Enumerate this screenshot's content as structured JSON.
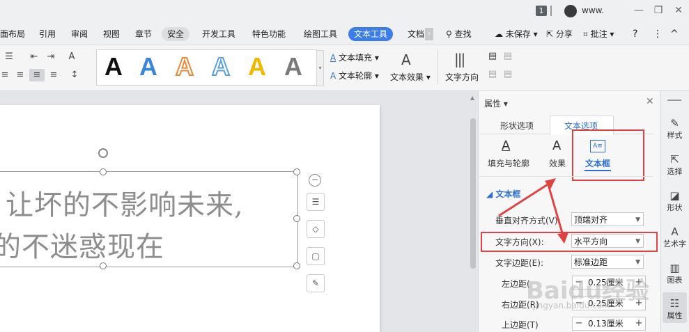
{
  "titlebar": {
    "badge": "1",
    "user": "www.",
    "win_minimize": "—",
    "win_restore": "❐",
    "win_close": "✕"
  },
  "menubar": {
    "items": [
      "面布局",
      "引用",
      "审阅",
      "视图",
      "章节",
      "安全",
      "开发工具",
      "特色功能",
      "绘图工具",
      "文本工具",
      "文档"
    ],
    "search": "查找",
    "unsaved": "未保存",
    "share": "分享",
    "comment": "批注",
    "help": "?",
    "more": "⋮",
    "collapse": "^"
  },
  "ribbon": {
    "text_fill": "文本填充",
    "text_outline": "文本轮廓",
    "text_effect": "文本效果",
    "text_direction": "文字方向",
    "art_letter": "A",
    "art_colors": [
      "#111111",
      "#3a86d8",
      "#e98a3a",
      "#5aa0e0",
      "#f0b800",
      "#7a7a7a"
    ]
  },
  "document": {
    "line1": "让坏的不影响未来,",
    "line2": "的不迷惑现在"
  },
  "panel": {
    "title": "属性",
    "tab_shape": "形状选项",
    "tab_text": "文本选项",
    "sub_fill": "填充与轮廓",
    "sub_effect": "效果",
    "sub_textbox": "文本框",
    "section": "文本框",
    "vert_align_label": "垂直对齐方式(V):",
    "vert_align_value": "顶端对齐",
    "direction_label": "文字方向(X):",
    "direction_value": "水平方向",
    "margin_label": "文字边距(E):",
    "margin_value": "标准边距",
    "left_margin_label": "左边距(",
    "left_margin_value": "0.25厘米",
    "right_margin_label": "右边距(R)",
    "right_margin_value": "0.25厘米",
    "top_margin_label": "上边距(T)",
    "top_margin_value": "0.13厘米",
    "accent": "#2b6fd6",
    "highlight": "#e04343"
  },
  "rail": {
    "items": [
      "样式",
      "选择",
      "形状",
      "艺术字",
      "图表",
      "属性"
    ]
  },
  "watermark": {
    "main": "Baidu经验",
    "sub": "jingyan.baidu.com"
  }
}
